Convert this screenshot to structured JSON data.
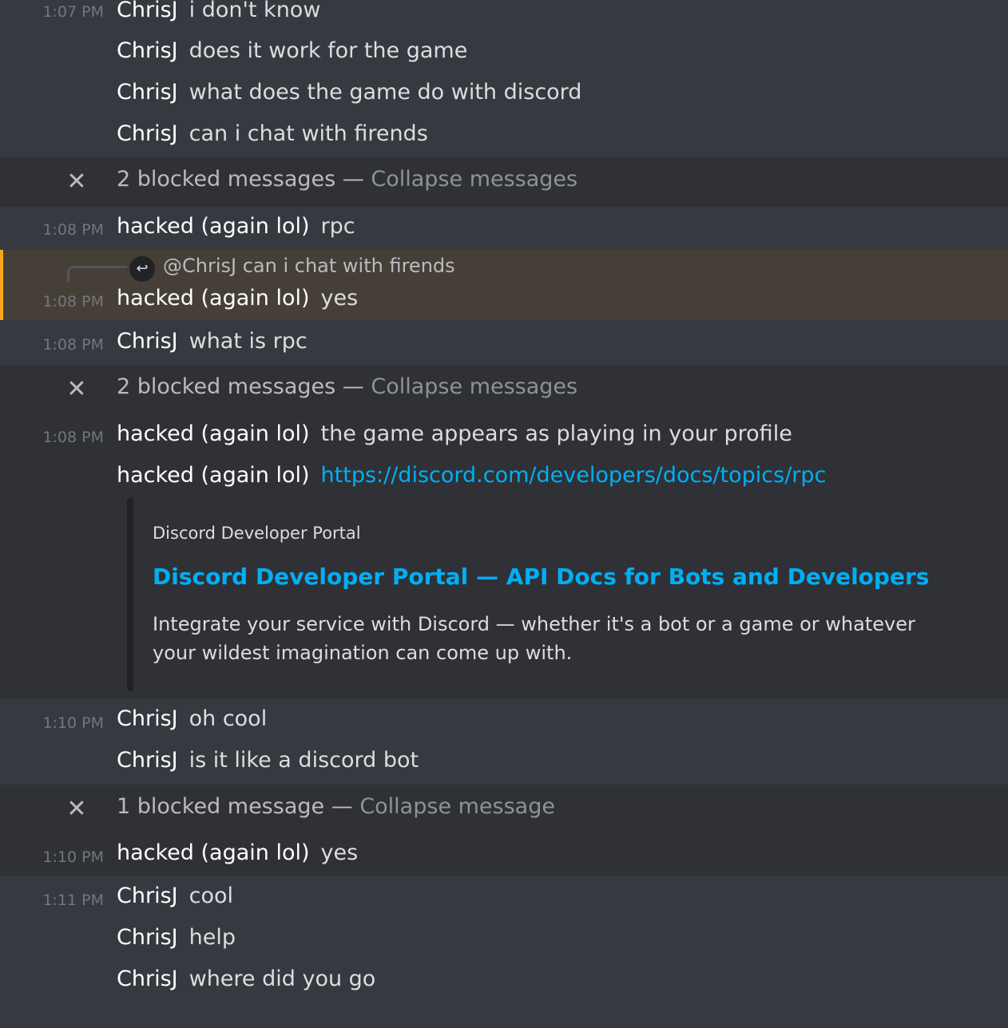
{
  "colors": {
    "background": "#36393f",
    "blocked_background": "#2f3136",
    "mention_highlight": "#463f37",
    "mention_bar": "#faa61a",
    "link": "#00aff4"
  },
  "messages": [
    {
      "time": "1:07 PM",
      "user": "ChrisJ",
      "text": "i don't know"
    },
    {
      "time": "",
      "user": "ChrisJ",
      "text": "does it work for the game"
    },
    {
      "time": "",
      "user": "ChrisJ",
      "text": "what does the game do with discord"
    },
    {
      "time": "",
      "user": "ChrisJ",
      "text": "can i chat with firends"
    }
  ],
  "blocked1": {
    "count": "2 blocked messages",
    "separator": "—",
    "action": "Collapse messages"
  },
  "msg_rpc": {
    "time": "1:08 PM",
    "user": "hacked (again lol)",
    "text": "rpc"
  },
  "reply": {
    "target": "@ChrisJ",
    "quoted": "can i chat with firends",
    "icon": "reply-arrow-icon"
  },
  "msg_yes1": {
    "time": "1:08 PM",
    "user": "hacked (again lol)",
    "text": "yes"
  },
  "msg_whatis": {
    "time": "1:08 PM",
    "user": "ChrisJ",
    "text": "what is rpc"
  },
  "blocked2": {
    "count": "2 blocked messages",
    "separator": "—",
    "action": "Collapse messages"
  },
  "msg_game": {
    "time": "1:08 PM",
    "user": "hacked (again lol)",
    "text": "the game appears as playing in your profile"
  },
  "msg_link": {
    "user": "hacked (again lol)",
    "url": "https://discord.com/developers/docs/topics/rpc"
  },
  "embed": {
    "provider": "Discord Developer Portal",
    "title": "Discord Developer Portal — API Docs for Bots and Developers",
    "description": "Integrate your service with Discord — whether it's a bot or a game or whatever your wildest imagination can come up with."
  },
  "msg_cool1": {
    "time": "1:10 PM",
    "user": "ChrisJ",
    "text": "oh cool"
  },
  "msg_bot": {
    "user": "ChrisJ",
    "text": "is it like a discord bot"
  },
  "blocked3": {
    "count": "1 blocked message",
    "separator": "—",
    "action": "Collapse message"
  },
  "msg_yes2": {
    "time": "1:10 PM",
    "user": "hacked (again lol)",
    "text": "yes"
  },
  "last_group": [
    {
      "time": "1:11 PM",
      "user": "ChrisJ",
      "text": "cool"
    },
    {
      "time": "",
      "user": "ChrisJ",
      "text": "help"
    },
    {
      "time": "",
      "user": "ChrisJ",
      "text": "where did you go"
    }
  ]
}
